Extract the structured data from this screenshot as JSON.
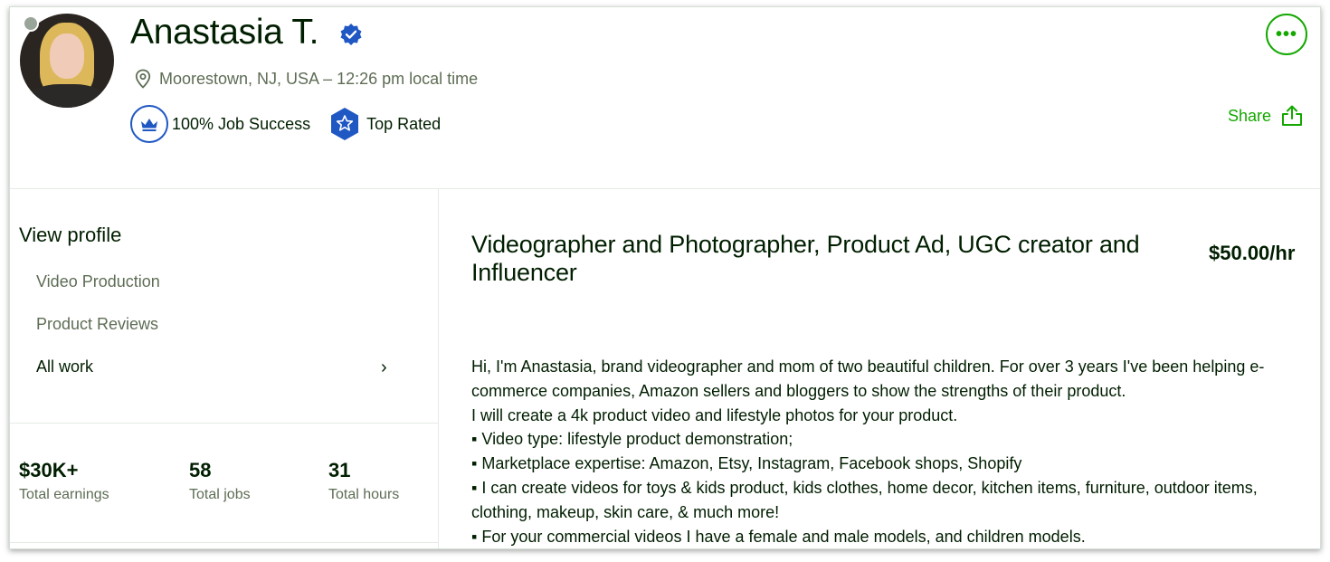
{
  "profile": {
    "name": "Anastasia T.",
    "location": "Moorestown, NJ, USA – 12:26 pm local time",
    "badges": {
      "job_success": "100% Job Success",
      "top_rated": "Top Rated"
    },
    "actions": {
      "more": "•••",
      "share": "Share"
    }
  },
  "sidebar": {
    "heading": "View profile",
    "items": [
      {
        "label": "Video Production"
      },
      {
        "label": "Product Reviews"
      },
      {
        "label": "All work"
      }
    ],
    "chevron": "›",
    "stats": [
      {
        "value": "$30K+",
        "label": "Total earnings"
      },
      {
        "value": "58",
        "label": "Total jobs"
      },
      {
        "value": "31",
        "label": "Total hours"
      }
    ]
  },
  "main": {
    "title": "Videographer and Photographer, Product Ad, UGC creator and Influencer",
    "rate": "$50.00/hr",
    "description_lines": [
      "Hi, I'm Anastasia, brand videographer and mom of two beautiful children. For over 3 years I've been helping e-",
      "commerce companies, Amazon sellers and bloggers to show the strengths of their product.",
      "I will create a 4k product video and lifestyle photos for your product.",
      "▪ Video type: lifestyle product demonstration;",
      "▪ Marketplace expertise: Amazon, Etsy, Instagram, Facebook shops, Shopify",
      "▪ I can create videos for toys & kids product, kids clothes, home decor, kitchen items, furniture, outdoor items,",
      "clothing, makeup, skin care, & much more!",
      "▪ For your commercial videos I have a female and male models, and children models."
    ]
  },
  "colors": {
    "accent_green": "#14a800",
    "badge_blue": "#1f57c3",
    "text": "#001e00",
    "muted": "#5e6d55"
  },
  "icons": [
    "verified-icon",
    "location-pin-icon",
    "crown-icon",
    "star-badge-icon",
    "more-icon",
    "share-icon",
    "chevron-right-icon"
  ]
}
